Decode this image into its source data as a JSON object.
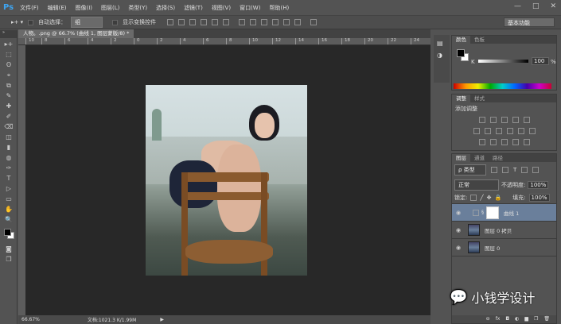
{
  "app": {
    "logo": "Ps",
    "menus": [
      "文件(F)",
      "编辑(E)",
      "图像(I)",
      "图层(L)",
      "类型(Y)",
      "选择(S)",
      "滤镜(T)",
      "视图(V)",
      "窗口(W)",
      "帮助(H)"
    ],
    "window_buttons": [
      "—",
      "□",
      "✕"
    ]
  },
  "options": {
    "auto_select_label": "自动选择：",
    "auto_select_value": "组",
    "show_transform_label": "显示变换控件",
    "workspace": "基本功能"
  },
  "document": {
    "tab_title": "人物。.png @ 66.7% (曲线 1, 图层蒙版/8) *",
    "close": "×",
    "ruler_ticks": [
      "10",
      "8",
      "6",
      "4",
      "2",
      "0",
      "2",
      "4",
      "6",
      "8",
      "10",
      "12",
      "14",
      "16",
      "18",
      "20",
      "22",
      "24"
    ]
  },
  "status": {
    "zoom": "66.67%",
    "doc_info": "文档:1021.3 K/1.99M",
    "arrow": "▶"
  },
  "tools": [
    "▸+",
    "⬚",
    "ʘ",
    "⌖",
    "⧉",
    "✎",
    "✚",
    "✐",
    "⌫",
    "◫",
    "▮",
    "◍",
    "✑",
    "T",
    "▷",
    "▭",
    "✋",
    "🔍"
  ],
  "color_panel": {
    "tabs": [
      "颜色",
      "色板"
    ],
    "channel": "K",
    "value": "100",
    "unit": "%"
  },
  "adjust_panel": {
    "tabs": [
      "调整",
      "样式"
    ],
    "title": "添加调整"
  },
  "layers_panel": {
    "tabs": [
      "图层",
      "通道",
      "路径"
    ],
    "filter": "ρ 类型",
    "blend_mode": "正常",
    "opacity_label": "不透明度:",
    "opacity": "100%",
    "lock_label": "锁定:",
    "fill_label": "填充:",
    "fill": "100%",
    "layers": [
      {
        "name": "曲线 1",
        "selected": true,
        "type": "adjustment"
      },
      {
        "name": "图层 0 拷贝",
        "selected": false,
        "type": "image"
      },
      {
        "name": "图层 0",
        "selected": false,
        "type": "image"
      }
    ],
    "footer_icons": [
      "link-icon",
      "fx-icon",
      "mask-icon",
      "adjustment-icon",
      "folder-icon",
      "new-layer-icon",
      "trash-icon"
    ],
    "footer_glyphs": [
      "⊖",
      "fx",
      "◘",
      "◐",
      "▆",
      "❐",
      "🗑"
    ]
  },
  "watermark": "小钱学设计",
  "colors": {
    "accent": "#3ea4f0",
    "canvas": "#282828",
    "selected_layer": "#6a7f9b"
  }
}
